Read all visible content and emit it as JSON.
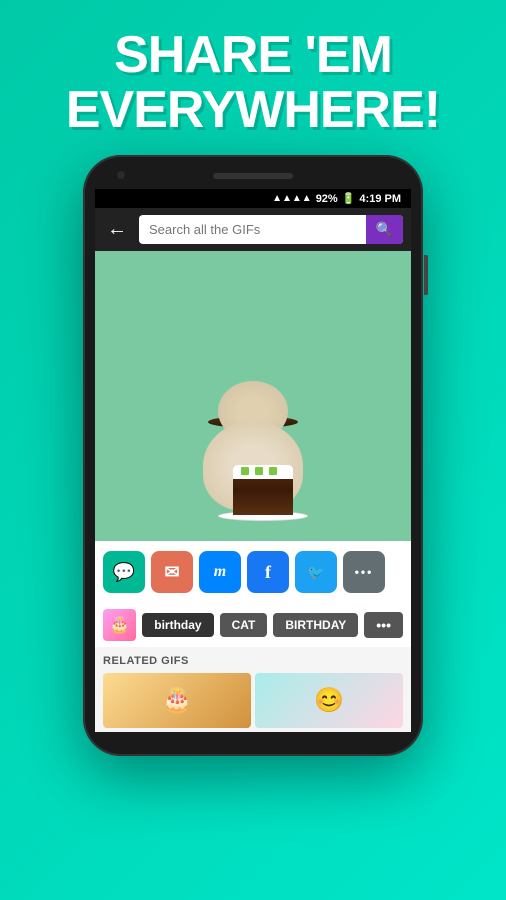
{
  "headline": {
    "line1": "SHARE 'EM",
    "line2": "EVERYWHERE!"
  },
  "status_bar": {
    "signal": "▲▲▲▲",
    "battery_percent": "92%",
    "time": "4:19 PM"
  },
  "search": {
    "placeholder": "Search all the GIFs",
    "icon": "🔍"
  },
  "share_buttons": [
    {
      "id": "chat",
      "label": "💬",
      "class": "btn-chat",
      "name": "share-chat-button"
    },
    {
      "id": "mail",
      "label": "✉",
      "class": "btn-mail",
      "name": "share-mail-button"
    },
    {
      "id": "messenger",
      "label": "m",
      "class": "btn-messenger",
      "name": "share-messenger-button"
    },
    {
      "id": "facebook",
      "label": "f",
      "class": "btn-facebook",
      "name": "share-facebook-button"
    },
    {
      "id": "twitter",
      "label": "🐦",
      "class": "btn-twitter",
      "name": "share-twitter-button"
    },
    {
      "id": "more",
      "label": "•••",
      "class": "btn-more",
      "name": "share-more-button"
    }
  ],
  "tags": [
    {
      "id": "birthday",
      "label": "birthday",
      "active": true,
      "name": "tag-birthday-active"
    },
    {
      "id": "cat",
      "label": "CAT",
      "active": false,
      "name": "tag-cat"
    },
    {
      "id": "birthday2",
      "label": "BIRTHDAY",
      "active": false,
      "name": "tag-birthday2"
    },
    {
      "id": "more",
      "label": "•••",
      "active": false,
      "name": "tag-more"
    }
  ],
  "related": {
    "label": "RELATED GIFS"
  },
  "back_arrow": "←"
}
